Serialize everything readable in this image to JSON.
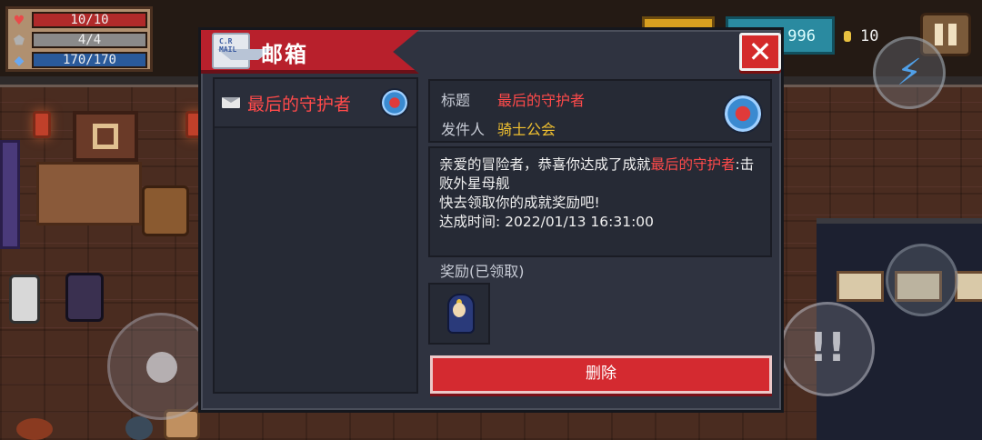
{
  "hud": {
    "hp": "10/10",
    "armor": "4/4",
    "energy": "170/170",
    "gems": "996",
    "coins": "10",
    "icons": {
      "hp": "heart-icon",
      "armor": "shield-icon",
      "energy": "diamond-icon",
      "skill": "lightning-icon",
      "attack": "attack-icon"
    }
  },
  "mailbox": {
    "logo_text_1": "C.R",
    "logo_text_2": "MAIL",
    "title": "邮箱",
    "close_glyph": "✕",
    "list": [
      {
        "name": "最后的守护者"
      }
    ],
    "detail": {
      "title_label": "标题",
      "title_value": "最后的守护者",
      "sender_label": "发件人",
      "sender_value": "骑士公会",
      "body_intro": "亲爱的冒险者，恭喜你达成了成就",
      "body_achievement": "最后的守护者",
      "body_suffix": ":击败外星母舰",
      "body_line2": "快去领取你的成就奖励吧!",
      "body_line3": "达成时间: 2022/01/13 16:31:00"
    },
    "reward_label": "奖励(已领取)",
    "delete_label": "删除"
  },
  "colors": {
    "accent_red": "#d42a2a",
    "highlight_red": "#ff4a4a",
    "sender_yellow": "#f0c030",
    "panel_bg": "#2f3340"
  }
}
